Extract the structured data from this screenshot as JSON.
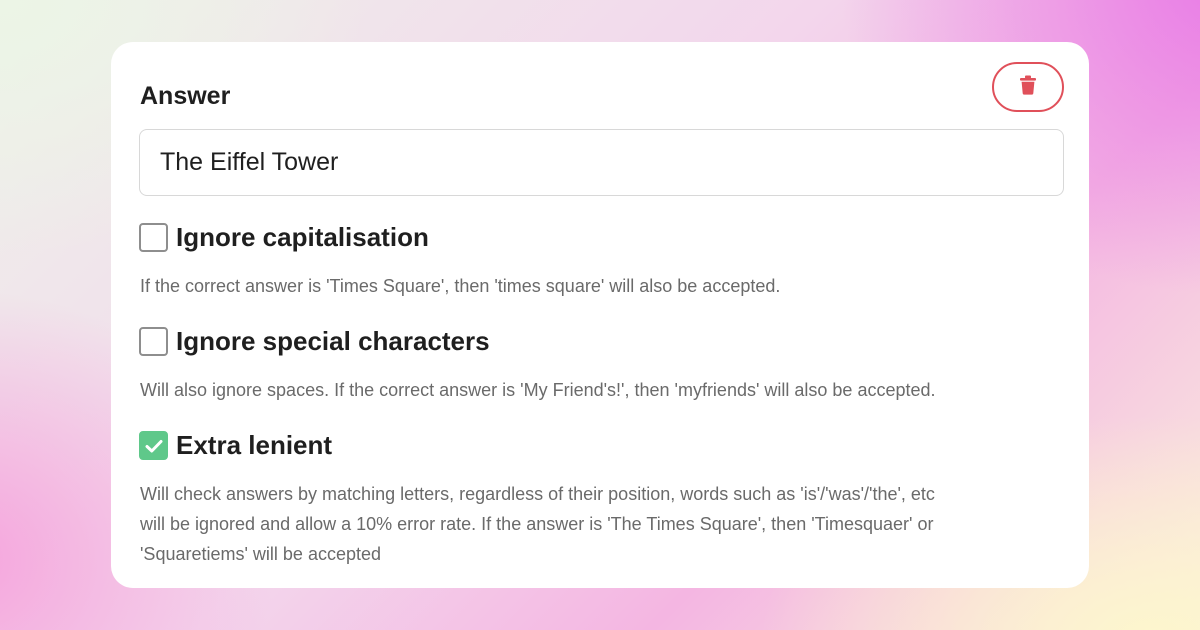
{
  "answer": {
    "title": "Answer",
    "value": "The Eiffel Tower"
  },
  "delete_button": {
    "icon": "trash-icon",
    "color": "#e0505a"
  },
  "options": [
    {
      "label": "Ignore capitalisation",
      "checked": false,
      "description": "If the correct answer is 'Times Square', then 'times square' will also be accepted."
    },
    {
      "label": "Ignore special characters",
      "checked": false,
      "description": "Will also ignore spaces. If the correct answer is 'My Friend's!', then 'myfriends' will also be accepted."
    },
    {
      "label": "Extra lenient",
      "checked": true,
      "description_lines": [
        "Will check answers by matching letters, regardless of their position, words such as 'is'/'was'/'the', etc",
        "will be ignored and allow a 10% error rate. If the answer is 'The Times Square', then 'Timesquaer' or",
        "'Squaretiems' will be accepted"
      ]
    }
  ],
  "colors": {
    "checked": "#5fc88a",
    "delete": "#e0505a"
  }
}
